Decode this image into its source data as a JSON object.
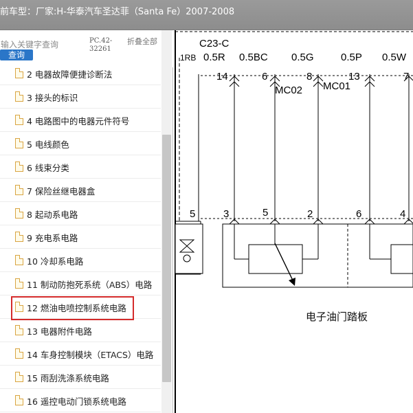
{
  "window": {
    "title": "前车型：厂家:H-华泰汽车圣达菲（Santa Fe）2007-2008"
  },
  "search": {
    "placeholder": "输入关键字查询",
    "button_label": "查询",
    "page_code": "PC.42-32261",
    "collapse_label": "折叠全部"
  },
  "toc": {
    "items": [
      {
        "label": "2 电器故障便捷诊断法"
      },
      {
        "label": "3 接头的标识"
      },
      {
        "label": "4 电路图中的电器元件符号"
      },
      {
        "label": "5 电线颜色"
      },
      {
        "label": "6 线束分类"
      },
      {
        "label": "7 保险丝继电器盒"
      },
      {
        "label": "8 起动系电路"
      },
      {
        "label": "9 充电系电路"
      },
      {
        "label": "10 冷却系电路"
      },
      {
        "label": "11 制动防抱死系统（ABS）电路"
      },
      {
        "label": "12 燃油电喷控制系统电路"
      },
      {
        "label": "13 电器附件电路"
      },
      {
        "label": "14 车身控制模块（ETACS）电路"
      },
      {
        "label": "15 雨刮洗涤系统电路"
      },
      {
        "label": "16 遥控电动门锁系统电路"
      }
    ],
    "selected_index": 10
  },
  "diagram": {
    "connector_top": "C23-C",
    "wires": [
      "1RB",
      "0.5R",
      "0.5BC",
      "0.5G",
      "0.5P",
      "0.5W"
    ],
    "pins_top": [
      "14",
      "6",
      "8",
      "13",
      "7"
    ],
    "splices": [
      "MC02",
      "MC01"
    ],
    "pins_bottom": [
      "5",
      "3",
      "5",
      "2",
      "6",
      "4"
    ],
    "component_label": "电子油门踏板"
  },
  "colors": {
    "titlebar": "#8d8d8d",
    "search_button": "#2a76c8",
    "highlight": "#d42a2a"
  }
}
